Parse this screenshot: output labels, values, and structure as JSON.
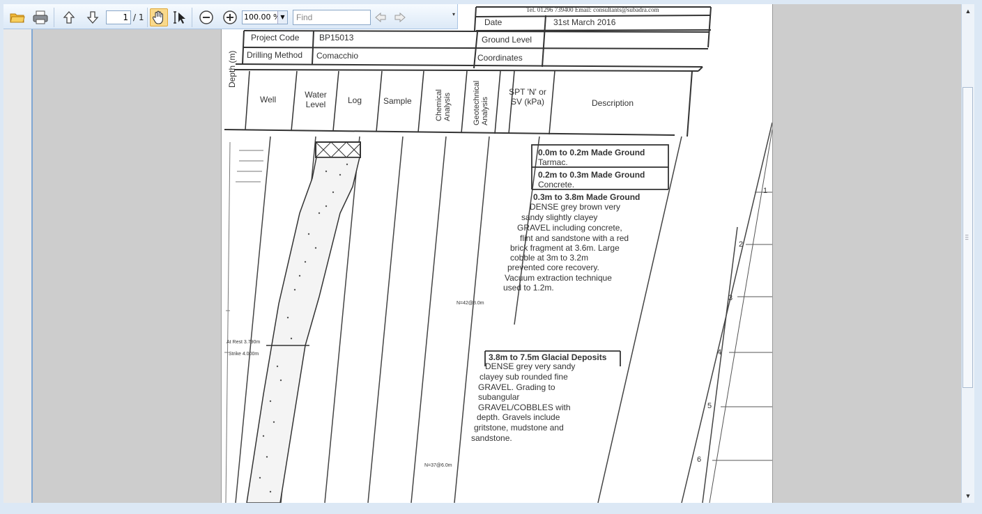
{
  "toolbar": {
    "page_current": "1",
    "page_total": "/ 1",
    "zoom": "100.00 %",
    "find_placeholder": "Find",
    "icons": [
      "open-folder-icon",
      "print-icon",
      "previous-page-icon",
      "next-page-icon",
      "hand-tool-icon",
      "select-text-icon",
      "zoom-out-icon",
      "zoom-in-icon",
      "find-previous-icon",
      "find-next-icon"
    ]
  },
  "document": {
    "contact": "Tel. 01296 739400   Email: consultants@subadra.com",
    "date_label": "Date",
    "date_value": "31st March 2016",
    "project_code_label": "Project Code",
    "project_code_value": "BP15013",
    "ground_level_label": "Ground Level",
    "drilling_method_label": "Drilling Method",
    "drilling_method_value": "Comacchio",
    "coordinates_label": "Coordinates",
    "columns": {
      "depth": "Depth (m)",
      "well": "Well",
      "water_level": "Water Level",
      "log": "Log",
      "sample": "Sample",
      "chemical_analysis": "Chemical Analysis",
      "geotechnical_analysis": "Geotechnical Analysis",
      "spt": "SPT 'N' or SV (kPa)",
      "description": "Description"
    },
    "strata": [
      {
        "title": "0.0m to 0.2m Made Ground",
        "text": "Tarmac."
      },
      {
        "title": "0.2m to 0.3m Made Ground",
        "text": "Concrete."
      },
      {
        "title": "0.3m to 3.8m Made Ground",
        "lines": [
          "DENSE grey brown very",
          "sandy slightly clayey",
          "GRAVEL including concrete,",
          "flint and sandstone with a red",
          "brick fragment at 3.6m. Large",
          "cobble at 3m to 3.2m",
          "prevented core recovery.",
          "Vacuum extraction technique",
          "used to 1.2m."
        ]
      },
      {
        "title": "3.8m to 7.5m Glacial Deposits",
        "lines": [
          "DENSE grey very sandy",
          "clayey sub rounded fine",
          "GRAVEL. Grading to",
          "subangular",
          "GRAVEL/COBBLES with",
          "depth. Gravels include",
          "gritstone, mudstone and",
          "sandstone."
        ]
      }
    ],
    "spt_values": [
      "N=42@3.0m",
      "N=37@6.0m"
    ],
    "water_notes": [
      "At Rest 3.790m",
      "Strike 4.000m"
    ],
    "depth_scale": [
      "1",
      "2",
      "3",
      "4",
      "5",
      "6"
    ]
  }
}
